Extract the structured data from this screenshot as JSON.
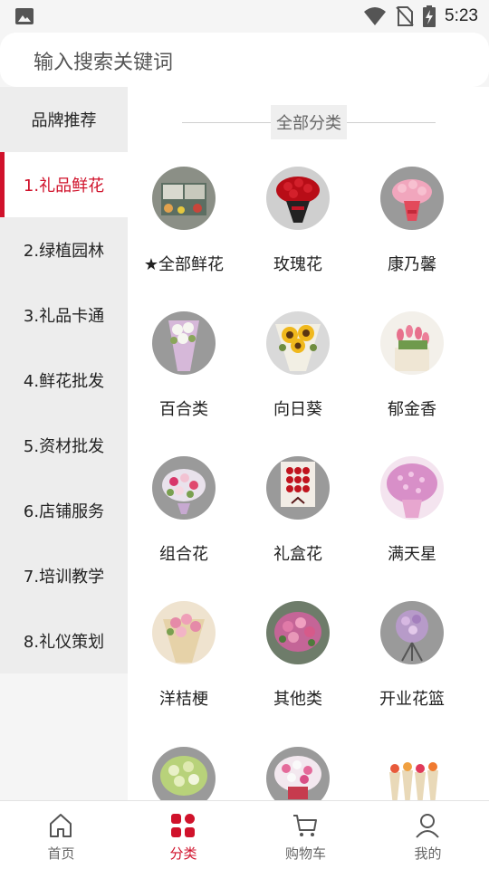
{
  "status_bar": {
    "time": "5:23"
  },
  "search": {
    "placeholder": "输入搜索关键词"
  },
  "sidebar": {
    "items": [
      {
        "label": "品牌推荐"
      },
      {
        "label": "1.礼品鲜花"
      },
      {
        "label": "2.绿植园林"
      },
      {
        "label": "3.礼品卡通"
      },
      {
        "label": "4.鲜花批发"
      },
      {
        "label": "5.资材批发"
      },
      {
        "label": "6.店铺服务"
      },
      {
        "label": "7.培训教学"
      },
      {
        "label": "8.礼仪策划"
      }
    ],
    "active_index": 1
  },
  "content": {
    "section_title": "全部分类",
    "categories": [
      {
        "name": "★全部鲜花",
        "icon": "flower-shop-image"
      },
      {
        "name": "玫瑰花",
        "icon": "red-roses-image"
      },
      {
        "name": "康乃馨",
        "icon": "carnation-bouquet-image"
      },
      {
        "name": "百合类",
        "icon": "lily-bouquet-image"
      },
      {
        "name": "向日葵",
        "icon": "sunflower-bouquet-image"
      },
      {
        "name": "郁金香",
        "icon": "tulip-bouquet-image"
      },
      {
        "name": "组合花",
        "icon": "mixed-bouquet-image"
      },
      {
        "name": "礼盒花",
        "icon": "flower-box-image"
      },
      {
        "name": "满天星",
        "icon": "babys-breath-image"
      },
      {
        "name": "洋桔梗",
        "icon": "eustoma-bouquet-image"
      },
      {
        "name": "其他类",
        "icon": "other-bouquet-image"
      },
      {
        "name": "开业花篮",
        "icon": "opening-basket-image"
      },
      {
        "name": "",
        "icon": "green-bouquet-image"
      },
      {
        "name": "",
        "icon": "daisy-basket-image"
      },
      {
        "name": "",
        "icon": "single-stems-image"
      }
    ]
  },
  "bottom_nav": {
    "items": [
      {
        "label": "首页",
        "icon": "home-icon"
      },
      {
        "label": "分类",
        "icon": "category-icon"
      },
      {
        "label": "购物车",
        "icon": "cart-icon"
      },
      {
        "label": "我的",
        "icon": "user-icon"
      }
    ],
    "active_index": 1
  },
  "colors": {
    "accent": "#d0122b",
    "sidebar_bg": "#ededed",
    "page_bg": "#f5f5f5"
  }
}
